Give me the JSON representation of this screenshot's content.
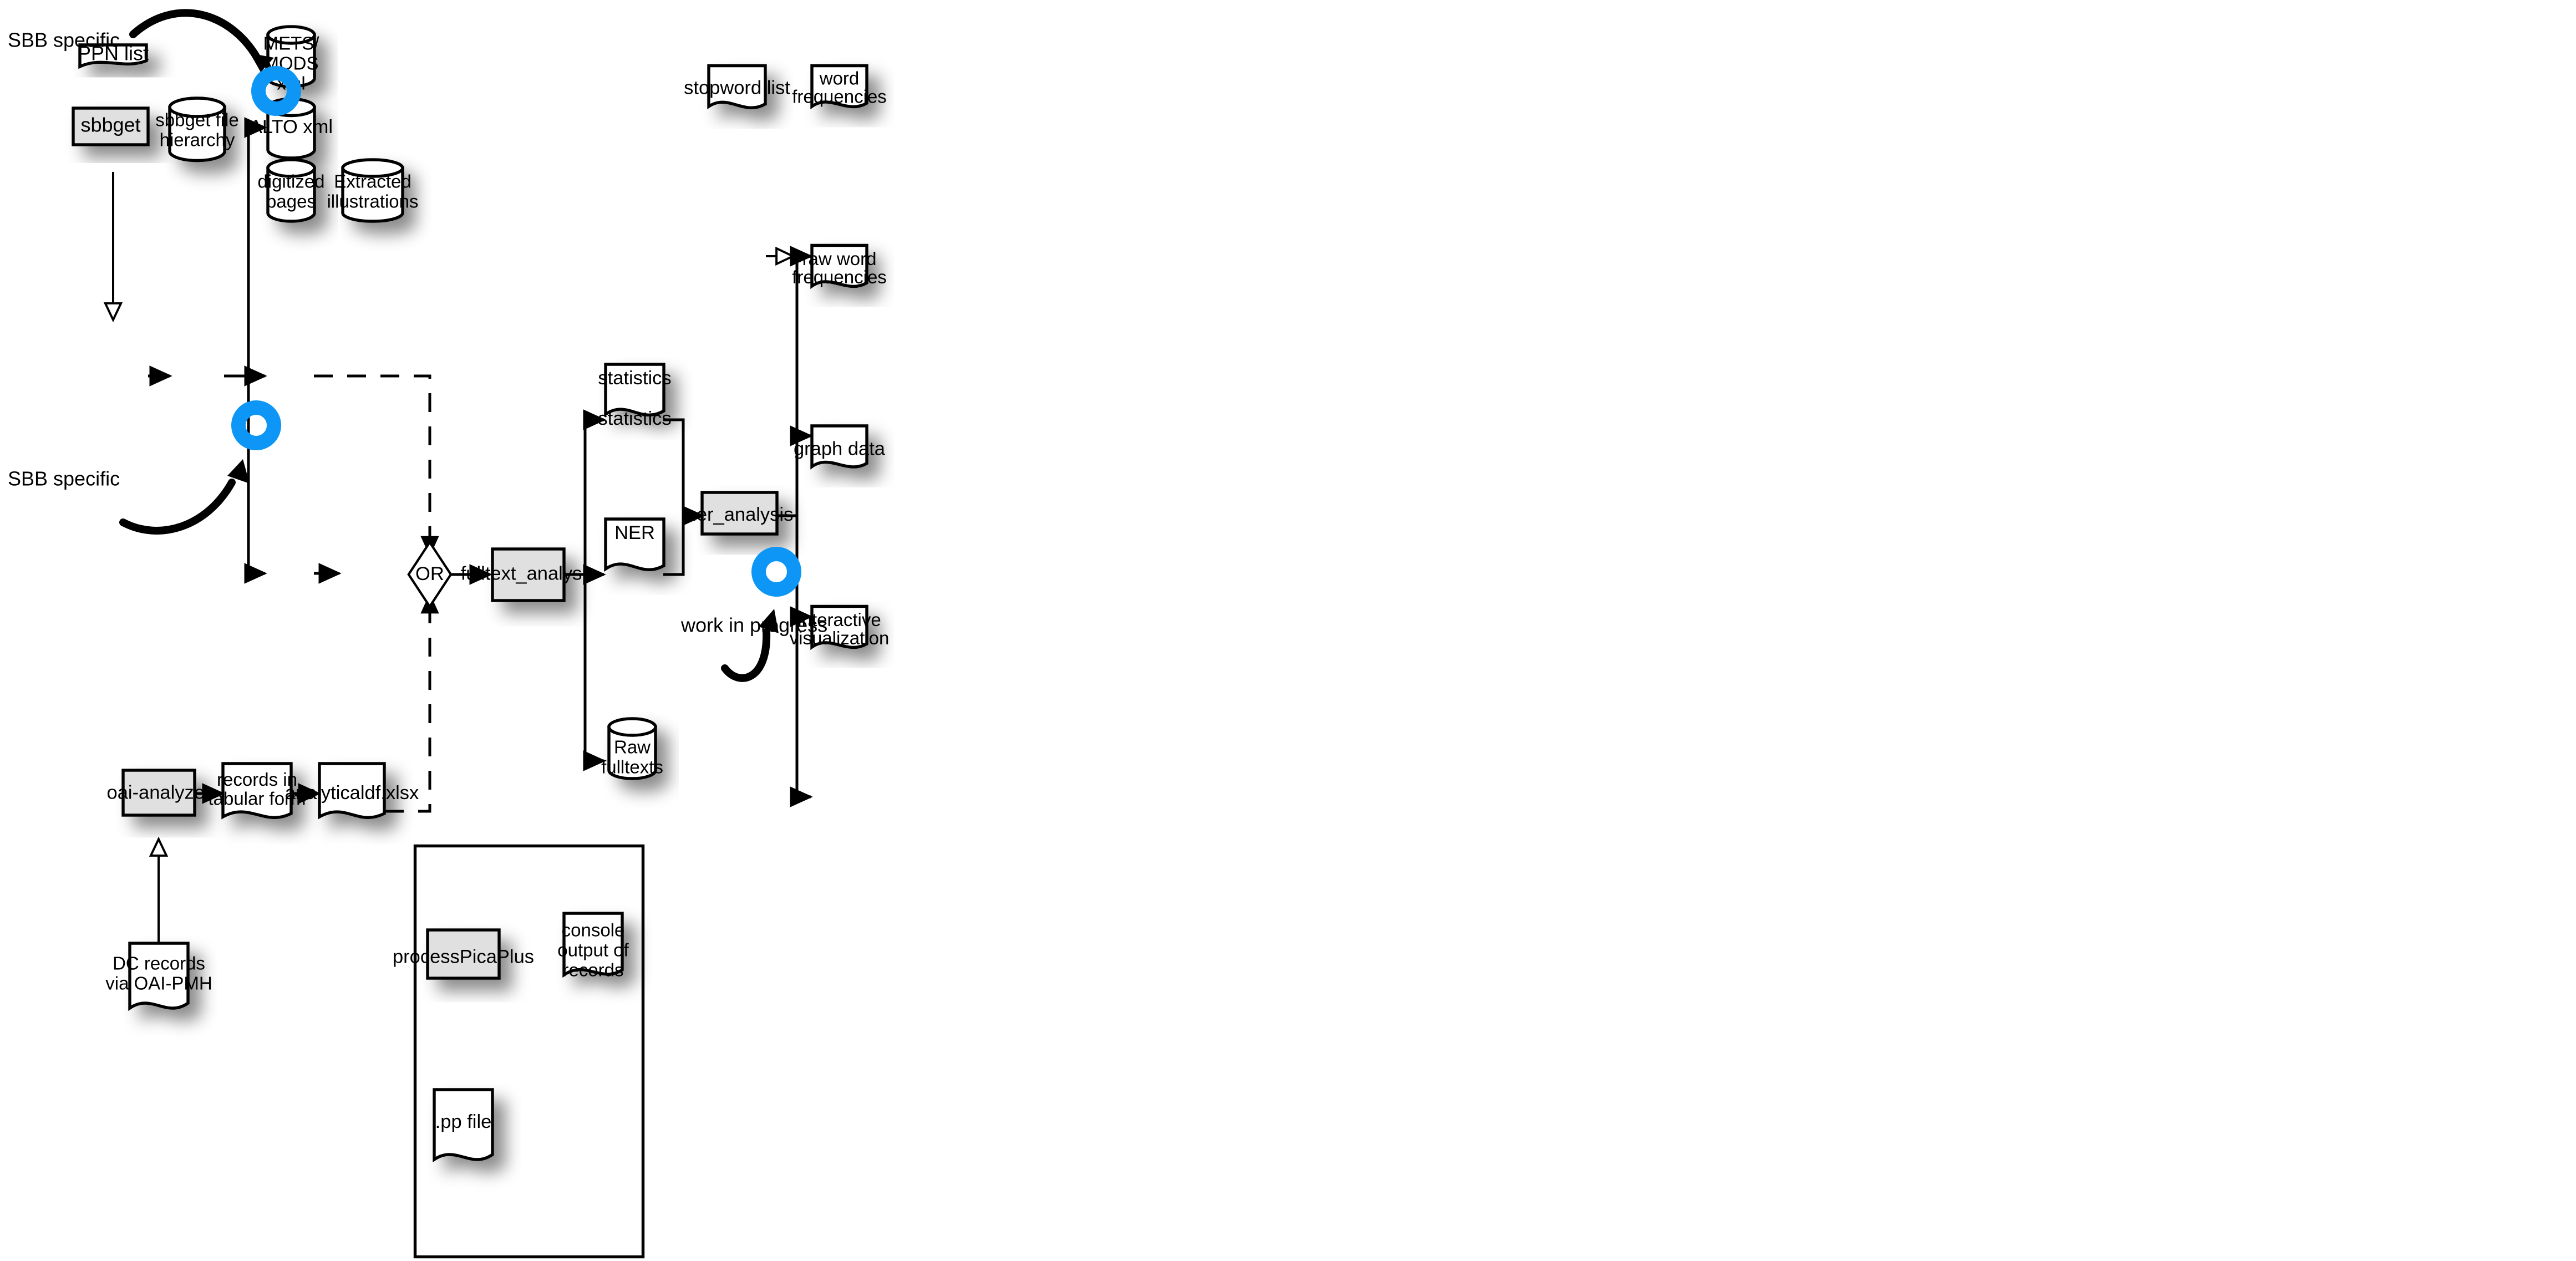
{
  "diagram": {
    "title_text_absent": true,
    "accent_color": "#0d96f5",
    "process_fill": "#e0e0e0",
    "line_color": "#000000"
  },
  "annotations": {
    "sbb_specific_top": "SBB specific",
    "sbb_specific_bottom": "SBB specific",
    "work_in_progress": "work in progress"
  },
  "nodes": {
    "ppn_list": "PPN list",
    "sbbget": "sbbget",
    "sbbget_file_hierarchy": "sbbget file\nhierarchy",
    "sbbget_file_hierarchy_l1": "sbbget file",
    "sbbget_file_hierarchy_l2": "hierarchy",
    "mets_mods_l1": "METS/",
    "mets_mods_l2": "MODS",
    "mets_mods_l3": "xml",
    "alto_xml": "ALTO xml",
    "digitized_pages_l1": "digitized",
    "digitized_pages_l2": "pages",
    "extracted_illustrations_l1": "Extracted",
    "extracted_illustrations_l2": "illustrations",
    "or_gate": "OR",
    "fulltext_analysis": "fulltext_analysis",
    "statistics": "statistics",
    "ner": "NER",
    "raw_fulltexts_l1": "Raw",
    "raw_fulltexts_l2": "fulltexts",
    "ner_analysis": "ner_analysis",
    "stopword_list": "stopword list",
    "word_frequencies_l1": "word",
    "word_frequencies_l2": "frequencies",
    "raw_word_frequencies_l1": "raw word",
    "raw_word_frequencies_l2": "frequencies",
    "graph_data": "graph data",
    "interactive_visualization_l1": "interactive",
    "interactive_visualization_l2": "visualization",
    "oai_analyzer": "oai-analyzer",
    "records_tabular_l1": "records in",
    "records_tabular_l2": "tabular form",
    "analyticaldf": "analyticaldf.xlsx",
    "dc_records_l1": "DC records",
    "dc_records_l2": "via OAI-PMH",
    "process_pica_plus": "processPicaPlus",
    "console_output_l1": "console",
    "console_output_l2": "output of",
    "console_output_l3": "records",
    "pp_file": ".pp file"
  }
}
